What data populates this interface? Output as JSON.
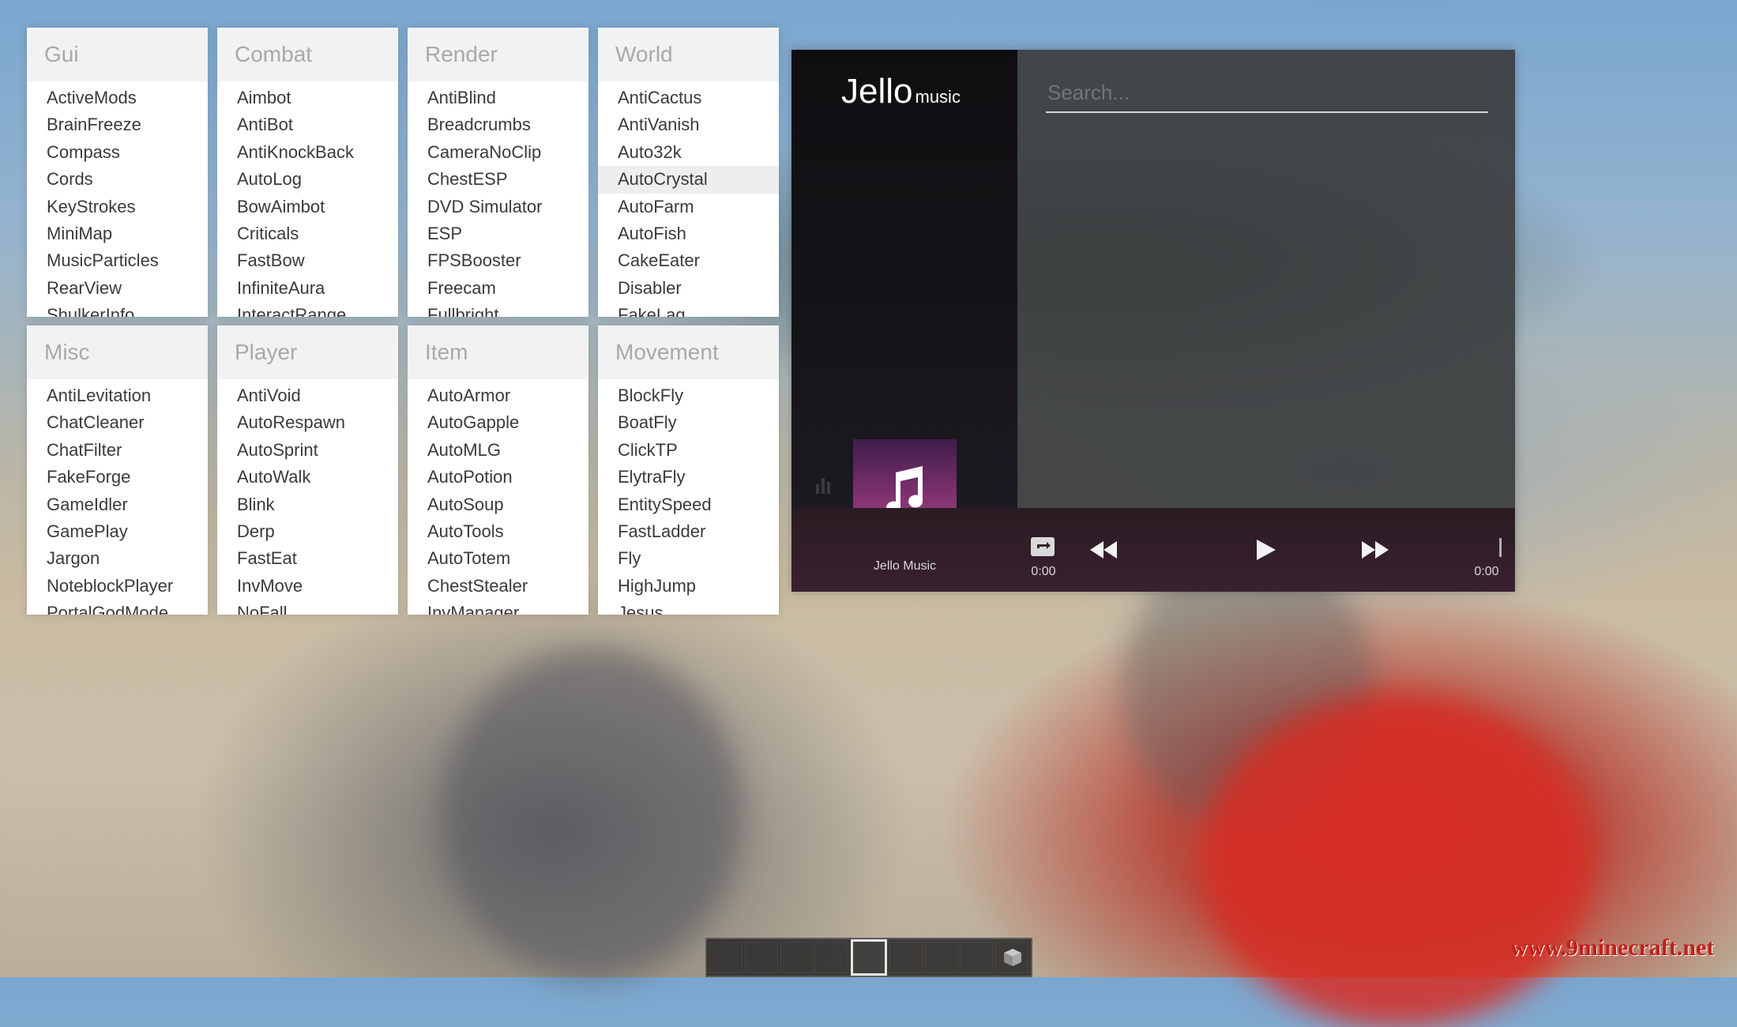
{
  "categories": [
    {
      "title": "Gui",
      "items": [
        "ActiveMods",
        "BrainFreeze",
        "Compass",
        "Cords",
        "KeyStrokes",
        "MiniMap",
        "MusicParticles",
        "RearView",
        "ShulkerInfo"
      ]
    },
    {
      "title": "Combat",
      "items": [
        "Aimbot",
        "AntiBot",
        "AntiKnockBack",
        "AutoLog",
        "BowAimbot",
        "Criticals",
        "FastBow",
        "InfiniteAura",
        "InteractRange"
      ]
    },
    {
      "title": "Render",
      "items": [
        "AntiBlind",
        "Breadcrumbs",
        "CameraNoClip",
        "ChestESP",
        "DVD Simulator",
        "ESP",
        "FPSBooster",
        "Freecam",
        "Fullbright"
      ]
    },
    {
      "title": "World",
      "items": [
        "AntiCactus",
        "AntiVanish",
        "Auto32k",
        "AutoCrystal",
        "AutoFarm",
        "AutoFish",
        "CakeEater",
        "Disabler",
        "FakeLag"
      ],
      "hovered_index": 3
    },
    {
      "title": "Misc",
      "items": [
        "AntiLevitation",
        "ChatCleaner",
        "ChatFilter",
        "FakeForge",
        "GameIdler",
        "GamePlay",
        "Jargon",
        "NoteblockPlayer",
        "PortalGodMode"
      ]
    },
    {
      "title": "Player",
      "items": [
        "AntiVoid",
        "AutoRespawn",
        "AutoSprint",
        "AutoWalk",
        "Blink",
        "Derp",
        "FastEat",
        "InvMove",
        "NoFall"
      ]
    },
    {
      "title": "Item",
      "items": [
        "AutoArmor",
        "AutoGapple",
        "AutoMLG",
        "AutoPotion",
        "AutoSoup",
        "AutoTools",
        "AutoTotem",
        "ChestStealer",
        "InvManager"
      ]
    },
    {
      "title": "Movement",
      "items": [
        "BlockFly",
        "BoatFly",
        "ClickTP",
        "ElytraFly",
        "EntitySpeed",
        "FastLadder",
        "Fly",
        "HighJump",
        "Jesus"
      ]
    }
  ],
  "music": {
    "logo_main": "Jello",
    "logo_sub": "music",
    "search_placeholder": "Search...",
    "playlist_name": "Jello Music",
    "time_elapsed": "0:00",
    "time_total": "0:00",
    "icons": {
      "visualizer": "bar-chart-icon",
      "cover": "music-note-icon",
      "repeat": "repeat-icon",
      "rewind": "rewind-icon",
      "play": "play-icon",
      "forward": "fast-forward-icon"
    }
  },
  "hotbar": {
    "slots": 9,
    "selected_index": 4
  },
  "watermark": "www.9minecraft.net"
}
